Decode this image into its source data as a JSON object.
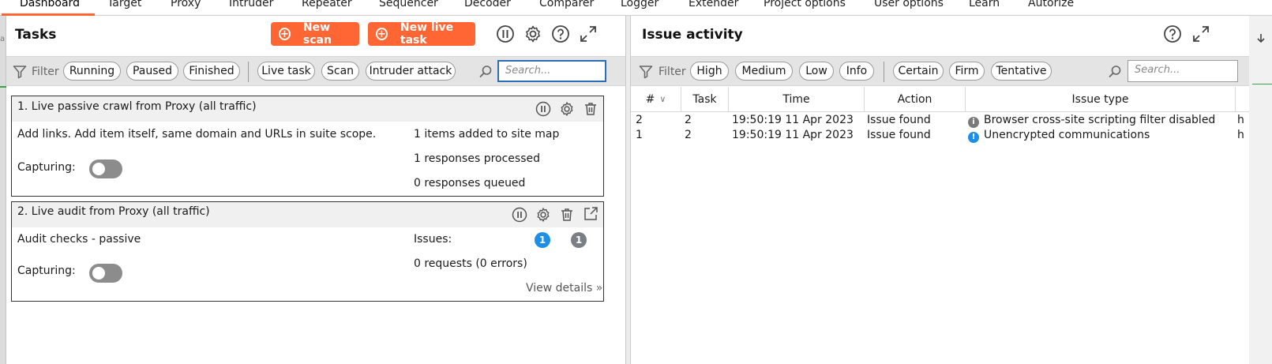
{
  "top_tabs": [
    {
      "label": "Dashboard"
    },
    {
      "label": "Target"
    },
    {
      "label": "Proxy"
    },
    {
      "label": "Intruder"
    },
    {
      "label": "Repeater"
    },
    {
      "label": "Sequencer"
    },
    {
      "label": "Decoder"
    },
    {
      "label": "Comparer"
    },
    {
      "label": "Logger"
    },
    {
      "label": "Extender"
    },
    {
      "label": "Project options"
    },
    {
      "label": "User options"
    },
    {
      "label": "Learn"
    },
    {
      "label": "Autorize"
    }
  ],
  "active_tab": "Dashboard",
  "left_strip_fragment": "a",
  "tasks": {
    "title": "Tasks",
    "new_scan_label": "New scan",
    "new_live_task_label": "New live task",
    "filter_label": "Filter",
    "filter_chips": [
      "Running",
      "Paused",
      "Finished"
    ],
    "type_chips": [
      "Live task",
      "Scan",
      "Intruder attack"
    ],
    "search_placeholder": "Search...",
    "cards": [
      {
        "title": "1. Live passive crawl from Proxy (all traffic)",
        "description": "Add links. Add item itself, same domain and URLs in suite scope.",
        "capturing_label": "Capturing:",
        "stats": [
          "1 items added to site map",
          "1 responses processed",
          "0 responses queued"
        ]
      },
      {
        "title": "2. Live audit from Proxy (all traffic)",
        "description": "Audit checks - passive",
        "capturing_label": "Capturing:",
        "issues_label": "Issues:",
        "issue_badges": [
          "1",
          "1"
        ],
        "requests_text": "0 requests (0 errors)",
        "view_details_label": "View details"
      }
    ]
  },
  "issue_activity": {
    "title": "Issue activity",
    "filter_label": "Filter",
    "severity_chips": [
      "High",
      "Medium",
      "Low",
      "Info"
    ],
    "confidence_chips": [
      "Certain",
      "Firm",
      "Tentative"
    ],
    "search_placeholder": "Search...",
    "columns": [
      "#",
      "Task",
      "Time",
      "Action",
      "Issue type"
    ],
    "rows": [
      {
        "num": "2",
        "task": "2",
        "time": "19:50:19 11 Apr 2023",
        "action": "Issue found",
        "issue_type": "Browser cross-site scripting filter disabled",
        "severity": "info",
        "trailing": "h"
      },
      {
        "num": "1",
        "task": "2",
        "time": "19:50:19 11 Apr 2023",
        "action": "Issue found",
        "issue_type": "Unencrypted communications",
        "severity": "low",
        "trailing": "h"
      }
    ]
  },
  "colors": {
    "accent": "#ff6633",
    "info_icon": "#7a7a7a",
    "low_icon": "#1e8fe6",
    "badge_blue": "#1e8fe6",
    "badge_grey": "#7a7f86",
    "focus_border": "#2d6db5"
  },
  "icons": {
    "pause": "pause-circle-icon",
    "settings": "gear-icon",
    "help": "question-circle-icon",
    "expand": "expand-icon",
    "delete": "trash-icon",
    "popout": "popout-icon",
    "filter": "funnel-icon",
    "search": "magnifier-icon"
  }
}
